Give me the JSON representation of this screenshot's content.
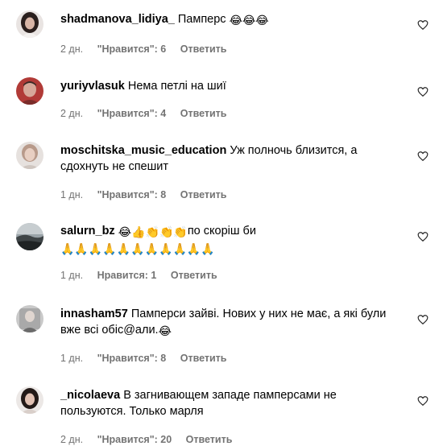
{
  "comments": [
    {
      "username": "shadmanova_lidiya_",
      "text": "Памперс",
      "emojis": "😂😂😂",
      "time": "2 дн.",
      "likes": "\"Нравится\": 6",
      "reply": "Ответить",
      "avatar": "avatar-woman-dark-hair"
    },
    {
      "username": "yuriyvlasuk",
      "text": "Нема петлі на шиї",
      "time": "2 дн.",
      "likes": "\"Нравится\": 4",
      "reply": "Ответить",
      "avatar": "avatar-man-red-bg"
    },
    {
      "username": "moschitska_music_education",
      "text": "Уж полночь близится, а сдохнуть не спешит",
      "time": "1 дн.",
      "likes": "\"Нравится\": 8",
      "reply": "Ответить",
      "avatar": "avatar-woman-light"
    },
    {
      "username": "salurn_bz",
      "emojis_before": "😂👍👏👏👏",
      "text": "по скоріш би",
      "emojis_after": "🙏🙏🙏🙏🙏🙏🙏🙏🙏🙏🙏",
      "time": "1 дн.",
      "likes": "Нравится: 1",
      "reply": "Ответить",
      "avatar": "avatar-landscape"
    },
    {
      "username": "innasham57",
      "text": "Памперси зайві. Нових у них не має, а які були вже всі обіс@али.",
      "emojis": "😂",
      "time": "1 дн.",
      "likes": "\"Нравится\": 8",
      "reply": "Ответить",
      "avatar": "avatar-gray-photo"
    },
    {
      "username": "_nicolaeva",
      "text": "В загнивающем западе памперсами не пользуются. Только марля",
      "time": "2 дн.",
      "likes": "\"Нравится\": 20",
      "reply": "Ответить",
      "avatar": "avatar-woman-dark"
    }
  ],
  "colors": {
    "text": "#000000",
    "meta": "#737373"
  },
  "icons": {
    "like": "heart-outline-icon"
  }
}
